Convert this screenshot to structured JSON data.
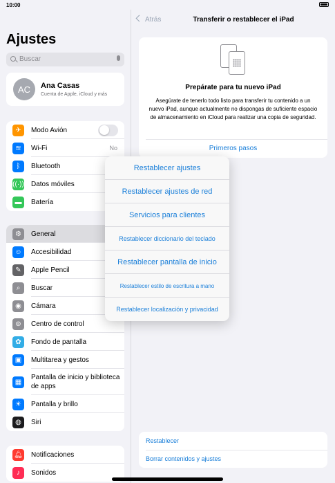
{
  "status": {
    "time": "10:00"
  },
  "sidebar": {
    "title": "Ajustes",
    "search_placeholder": "Buscar",
    "profile": {
      "initials": "AC",
      "name": "Ana Casas",
      "subtitle": "Cuenta de Apple, iCloud y más"
    },
    "group1": [
      {
        "label": "Modo Avión",
        "icon": "airplane-icon",
        "color": "#ff9500"
      },
      {
        "label": "Wi-Fi",
        "icon": "wifi-icon",
        "color": "#007aff",
        "value": "No"
      },
      {
        "label": "Bluetooth",
        "icon": "bluetooth-icon",
        "color": "#007aff"
      },
      {
        "label": "Datos móviles",
        "icon": "antenna-icon",
        "color": "#34c759"
      },
      {
        "label": "Batería",
        "icon": "battery-icon",
        "color": "#34c759"
      }
    ],
    "group2": [
      {
        "label": "General",
        "icon": "gear-icon",
        "color": "#8e8e93",
        "selected": true
      },
      {
        "label": "Accesibilidad",
        "icon": "accessibility-icon",
        "color": "#007aff"
      },
      {
        "label": "Apple Pencil",
        "icon": "pencil-icon",
        "color": "#636366"
      },
      {
        "label": "Buscar",
        "icon": "search-icon",
        "color": "#8e8e93"
      },
      {
        "label": "Cámara",
        "icon": "camera-icon",
        "color": "#8e8e93"
      },
      {
        "label": "Centro de control",
        "icon": "switches-icon",
        "color": "#8e8e93"
      },
      {
        "label": "Fondo de pantalla",
        "icon": "flower-icon",
        "color": "#32ade6"
      },
      {
        "label": "Multitarea y gestos",
        "icon": "multitask-icon",
        "color": "#007aff"
      },
      {
        "label": "Pantalla de inicio y biblioteca de apps",
        "icon": "home-screen-icon",
        "color": "#007aff"
      },
      {
        "label": "Pantalla y brillo",
        "icon": "sun-icon",
        "color": "#007aff"
      },
      {
        "label": "Siri",
        "icon": "siri-icon",
        "color": "#1c1c1e"
      }
    ],
    "group3": [
      {
        "label": "Notificaciones",
        "icon": "bell-icon",
        "color": "#ff3b30"
      },
      {
        "label": "Sonidos",
        "icon": "speaker-icon",
        "color": "#ff2d55"
      }
    ]
  },
  "detail": {
    "back_label": "Atrás",
    "title": "Transferir o restablecer el iPad",
    "prep_title": "Prepárate para tu nuevo iPad",
    "prep_text": "Asegúrate de tenerlo todo listo para transferir tu contenido a un nuevo iPad, aunque actualmente no dispongas de suficiente espacio de almacenamiento en iCloud para realizar una copia de seguridad.",
    "prep_link": "Primeros pasos",
    "reset_label": "Restablecer",
    "erase_label": "Borrar contenidos y ajustes"
  },
  "menu": [
    "Restablecer ajustes",
    "Restablecer ajustes de red",
    "Servicios para clientes",
    "Restablecer diccionario del teclado",
    "Restablecer pantalla de inicio",
    "Restablecer estilo de escritura a mano",
    "Restablecer localización y privacidad"
  ]
}
